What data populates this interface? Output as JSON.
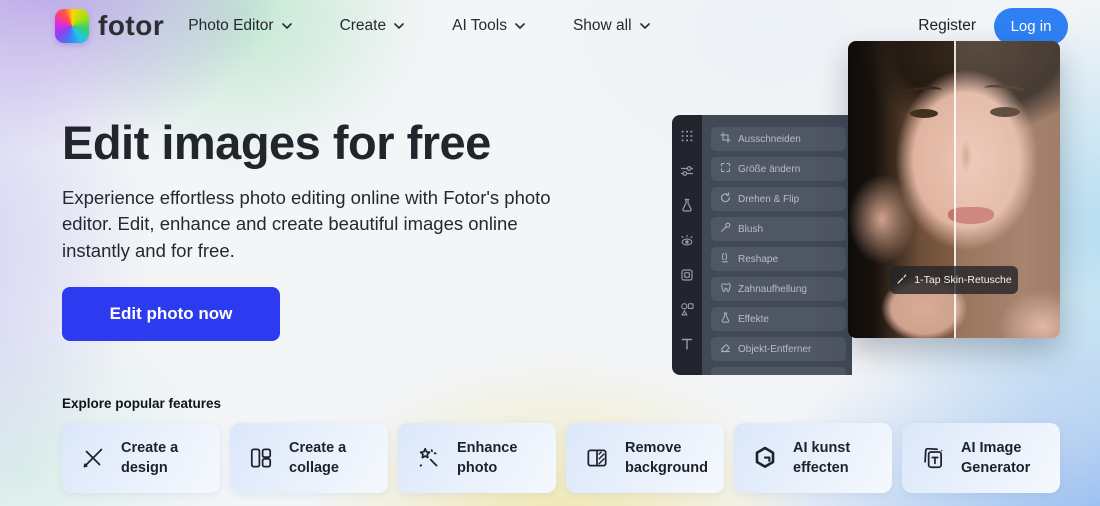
{
  "brand": {
    "name": "fotor"
  },
  "nav": {
    "items": [
      {
        "label": "Photo Editor"
      },
      {
        "label": "Create"
      },
      {
        "label": "AI Tools"
      },
      {
        "label": "Show all"
      }
    ],
    "register_label": "Register",
    "login_label": "Log in"
  },
  "hero": {
    "title": "Edit images for free",
    "description": "Experience effortless photo editing online with Fotor's photo editor. Edit, enhance and create beautiful images online instantly and for free.",
    "cta_label": "Edit photo now"
  },
  "editor_mockup": {
    "rail_icons": [
      "apps-grid-icon",
      "adjust-sliders-icon",
      "flask-icon",
      "beauty-eye-icon",
      "frame-icon",
      "elements-shapes-icon",
      "text-tool-icon"
    ],
    "menu_items": [
      {
        "label": "Ausschneiden",
        "icon": "crop-icon"
      },
      {
        "label": "Größe ändern",
        "icon": "resize-icon"
      },
      {
        "label": "Drehen & Flip",
        "icon": "rotate-icon"
      },
      {
        "label": "Blush",
        "icon": "blush-brush-icon"
      },
      {
        "label": "Reshape",
        "icon": "reshape-pinch-icon"
      },
      {
        "label": "Zahnaufhellung",
        "icon": "tooth-icon"
      },
      {
        "label": "Effekte",
        "icon": "effects-flask-icon"
      },
      {
        "label": "Objekt-Entferner",
        "icon": "eraser-icon"
      }
    ],
    "photo_badge": {
      "label": "1-Tap Skin-Retusche",
      "icon": "magic-wand-icon"
    }
  },
  "features": {
    "heading": "Explore popular features",
    "cards": [
      {
        "label": "Create a design",
        "icon": "design-pencils-icon"
      },
      {
        "label": "Create a collage",
        "icon": "collage-layout-icon"
      },
      {
        "label": "Enhance photo",
        "icon": "enhance-wand-star-icon"
      },
      {
        "label": "Remove background",
        "icon": "remove-background-icon"
      },
      {
        "label": "AI kunst effecten",
        "icon": "goart-hexagon-icon"
      },
      {
        "label": "AI Image Generator",
        "icon": "ai-image-cards-icon"
      }
    ]
  },
  "colors": {
    "login_blue": "#2e80f3",
    "cta_blue": "#2c3bf0"
  }
}
